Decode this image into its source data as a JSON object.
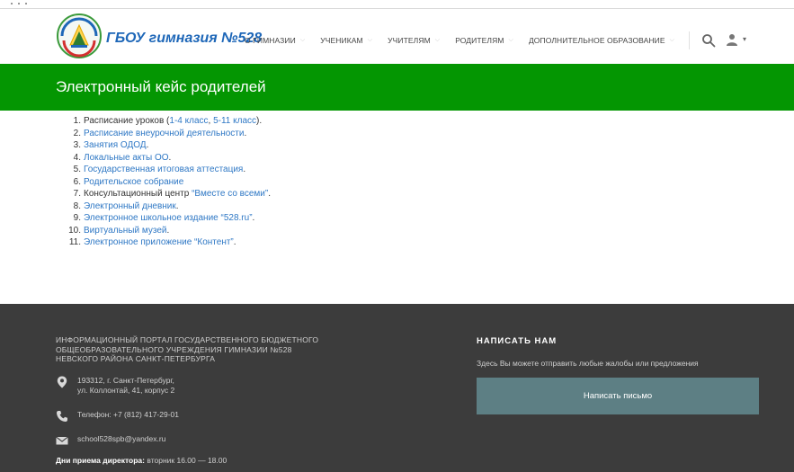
{
  "header": {
    "brand": "ГБОУ гимназия №528",
    "nav": [
      {
        "label": "О гимназии"
      },
      {
        "label": "Ученикам"
      },
      {
        "label": "Учителям"
      },
      {
        "label": "Родителям"
      },
      {
        "label": "Дополнительное образование"
      }
    ]
  },
  "page": {
    "title": "Электронный кейс родителей"
  },
  "items": [
    {
      "num": "1.",
      "pre": "Расписание уроков (",
      "link1": "1-4 класс",
      "mid": ", ",
      "link2": "5-11 класс",
      "post": ")."
    },
    {
      "num": "2.",
      "link": "Расписание внеурочной деятельности",
      "post": "."
    },
    {
      "num": "3.",
      "link": "Занятия ОДОД",
      "post": "."
    },
    {
      "num": "4.",
      "link": "Локальные акты ОО",
      "post": "."
    },
    {
      "num": "5.",
      "link": "Государственная итоговая аттестация",
      "post": "."
    },
    {
      "num": "6.",
      "link": "Родительское собрание",
      "post": ""
    },
    {
      "num": "7.",
      "pre": "Консультационный центр ",
      "link": "“Вместе со всеми”",
      "post": "."
    },
    {
      "num": "8.",
      "link": "Электронный дневник",
      "post": "."
    },
    {
      "num": "9.",
      "link": "Электронное школьное издание “528.ru”",
      "post": "."
    },
    {
      "num": "10.",
      "link": "Виртуальный музей",
      "post": "."
    },
    {
      "num": "11.",
      "link": "Электронное приложение “Контент”",
      "post": "."
    }
  ],
  "footer": {
    "org_lines": [
      "Информационный портал государственного бюджетного",
      "общеобразовательного учреждения гимназии №528",
      "Невского района Санкт-Петербурга"
    ],
    "address_line1": "193312, г. Санкт-Петербург,",
    "address_line2": "ул. Коллонтай, 41, корпус 2",
    "phone": "Телефон: +7 (812) 417-29-01",
    "email": "school528spb@yandex.ru",
    "hours_label": "Дни приема директора:",
    "hours_value": " вторник 16.00 — 18.00",
    "write_title": "Написать нам",
    "write_desc": "Здесь Вы можете отправить любые жалобы или предложения",
    "write_button": "Написать письмо"
  },
  "colors": {
    "banner": "#049602",
    "brand": "#1e67b8",
    "link": "#2f78c5",
    "footer": "#3c3c3c",
    "button": "#5d7f84"
  },
  "icons": {
    "logo": "school-emblem-logo",
    "search": "search-icon",
    "user": "user-icon",
    "address": "map-marker-icon",
    "phone": "phone-icon",
    "email": "envelope-icon"
  }
}
